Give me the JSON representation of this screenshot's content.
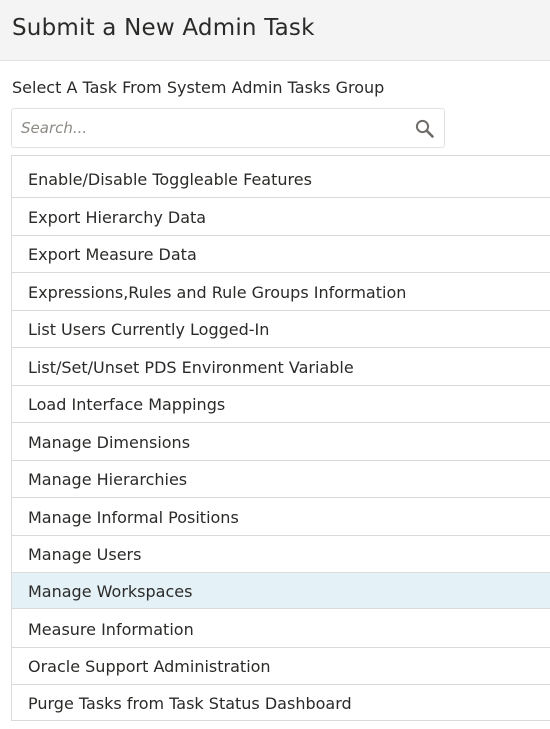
{
  "header": {
    "title": "Submit a New Admin Task"
  },
  "task_group": {
    "label": "Select A Task From System Admin Tasks Group"
  },
  "search": {
    "placeholder": "Search...",
    "value": "",
    "icon": "search-icon"
  },
  "colors": {
    "header_bg": "#f4f4f4",
    "selected_row_bg": "#e4f1f7",
    "border": "#dcdad6",
    "text": "#2b2a28"
  },
  "tasks": [
    {
      "label": "Enable/Disable Toggleable Features",
      "selected": false
    },
    {
      "label": "Export Hierarchy Data",
      "selected": false
    },
    {
      "label": "Export Measure Data",
      "selected": false
    },
    {
      "label": "Expressions,Rules and Rule Groups Information",
      "selected": false
    },
    {
      "label": "List Users Currently Logged-In",
      "selected": false
    },
    {
      "label": "List/Set/Unset PDS Environment Variable",
      "selected": false
    },
    {
      "label": "Load Interface Mappings",
      "selected": false
    },
    {
      "label": "Manage Dimensions",
      "selected": false
    },
    {
      "label": "Manage Hierarchies",
      "selected": false
    },
    {
      "label": "Manage Informal Positions",
      "selected": false
    },
    {
      "label": "Manage Users",
      "selected": false
    },
    {
      "label": "Manage Workspaces",
      "selected": true
    },
    {
      "label": "Measure Information",
      "selected": false
    },
    {
      "label": "Oracle Support Administration",
      "selected": false
    },
    {
      "label": "Purge Tasks from Task Status Dashboard",
      "selected": false
    }
  ]
}
